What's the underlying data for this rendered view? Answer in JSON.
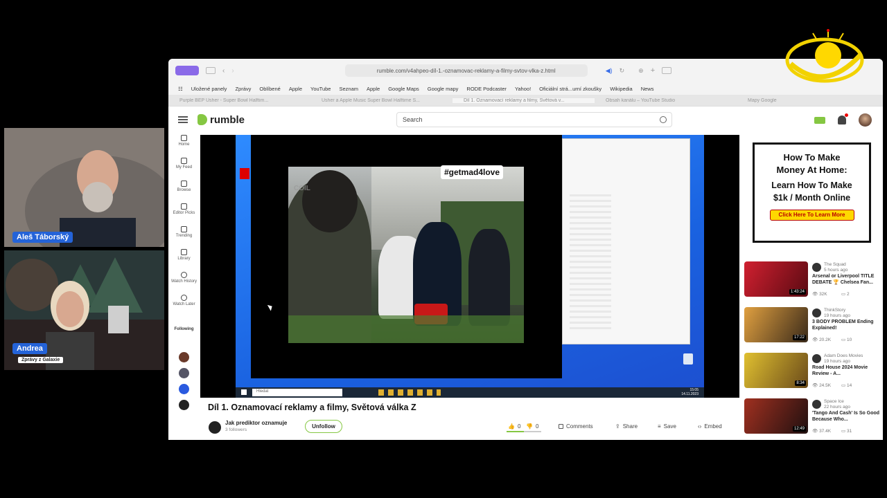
{
  "webcams": [
    {
      "name": "Aleš Táborský"
    },
    {
      "name": "Andrea",
      "subtitle": "Zprávy z Galaxie"
    }
  ],
  "browser": {
    "url": "rumble.com/v4ahpeo-díl-1.-oznamovac-reklamy-a-filmy-svtov-vlka-z.html",
    "bookmarks": [
      "Uložené panely",
      "Zprávy",
      "Oblíbené",
      "Apple",
      "YouTube",
      "Seznam",
      "Apple",
      "Google Maps",
      "Google mapy",
      "RODE Podcaster",
      "Yahoo!",
      "Oficiální strá...urní zkoušky",
      "Wikipedia",
      "News"
    ],
    "tabs": [
      "Purple BEP Usher - Super Bowl Halftim...",
      "Usher a Apple Music Super Bowl Halftime S...",
      "Díl 1. Oznamovací reklamy a filmy, Světová v...",
      "Obsah kanálu – YouTube Studio",
      "Mapy Google"
    ]
  },
  "header": {
    "logo_text": "rumble",
    "search_placeholder": "Search"
  },
  "leftnav": {
    "items": [
      {
        "label": "Home",
        "icon": "home-icon"
      },
      {
        "label": "My Feed",
        "icon": "feed-icon"
      },
      {
        "label": "Browse",
        "icon": "browse-icon"
      },
      {
        "label": "Editor Picks",
        "icon": "editor-picks-icon"
      },
      {
        "label": "Trending",
        "icon": "trending-icon"
      },
      {
        "label": "Library",
        "icon": "library-icon"
      },
      {
        "label": "Watch History",
        "icon": "history-icon"
      },
      {
        "label": "Watch Later",
        "icon": "clock-icon"
      }
    ],
    "following_label": "Following"
  },
  "video": {
    "hashtag": "#getmad4love",
    "watermark": "COIL",
    "taskbar_search": "Hledat",
    "taskbar_clock": "15:05\n14.11.2023",
    "title": "Díl 1. Oznamovací reklamy a filmy, Světová válka Z",
    "channel": "Jak prediktor oznamuje",
    "followers": "3 followers",
    "unfollow_label": "Unfollow",
    "likes": "0",
    "dislikes": "0",
    "like_ratio": 0.5,
    "actions": [
      "Comments",
      "Share",
      "Save",
      "Embed"
    ]
  },
  "ad": {
    "line1a": "How To Make",
    "line1b": "Money At Home:",
    "line2a": "Learn How To Make",
    "line2b": "$1k / Month Online",
    "cta": "Click Here To Learn More"
  },
  "recommendations": [
    {
      "channel": "The Squad",
      "time": "5 hours ago",
      "title": "Arsenal or Liverpool TITLE DEBATE 🏆 Chelsea Fan...",
      "views": "32K",
      "comments": "2",
      "duration": "1:43:24",
      "thumb_color": "#b8202a"
    },
    {
      "channel": "ThinkStory",
      "time": "19 hours ago",
      "title": "3 BODY PROBLEM Ending Explained!",
      "views": "20.2K",
      "comments": "10",
      "duration": "17:22",
      "thumb_color": "#7a5a3a"
    },
    {
      "channel": "Adam Does Movies",
      "time": "19 hours ago",
      "title": "Road House 2024 Movie Review - A...",
      "views": "24.5K",
      "comments": "14",
      "duration": "8:34",
      "thumb_color": "#a08020"
    },
    {
      "channel": "Space Ice",
      "time": "22 hours ago",
      "title": "'Tango And Cash' Is So Good Because Who...",
      "views": "37.4K",
      "comments": "31",
      "duration": "12:49",
      "thumb_color": "#8a2a1a"
    }
  ],
  "colors": {
    "brand": "#85c742",
    "accent": "#2463d8"
  }
}
